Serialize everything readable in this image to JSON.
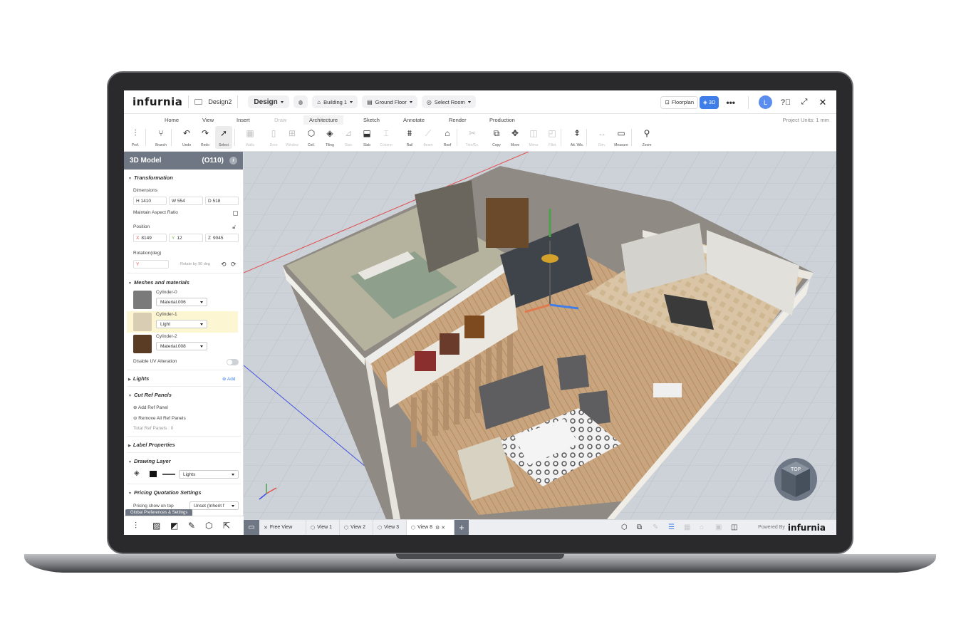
{
  "app": {
    "logo": "infurnia",
    "document_name": "Design2",
    "mode_label": "Design",
    "building": "Building 1",
    "floor": "Ground Floor",
    "room": "Select Room",
    "floorplan_label": "Floorplan",
    "view_3d_label": "3D",
    "more_label": "•••",
    "avatar_initial": "L",
    "help_icon": "question-circle-icon",
    "fullscreen_icon": "expand-icon",
    "close_icon": "close-icon"
  },
  "menu": {
    "tabs": [
      "Home",
      "View",
      "Insert",
      "Draw",
      "Architecture",
      "Sketch",
      "Annotate",
      "Render",
      "Production"
    ],
    "active": "Architecture",
    "project_units": "Project Units:  1 mm"
  },
  "toolbar": {
    "tools": [
      {
        "label": "Prof.",
        "glyph": "⫶"
      },
      {
        "label": "Branch",
        "glyph": "⑂"
      },
      {
        "label": "Undo",
        "glyph": "↶"
      },
      {
        "label": "Redo",
        "glyph": "↷"
      },
      {
        "label": "Select",
        "glyph": "➚"
      },
      {
        "label": "Walls",
        "glyph": "▦"
      },
      {
        "label": "Door",
        "glyph": "▯"
      },
      {
        "label": "Window",
        "glyph": "⊞"
      },
      {
        "label": "Ceil.",
        "glyph": "⬡"
      },
      {
        "label": "Tiling",
        "glyph": "◈"
      },
      {
        "label": "Stair",
        "glyph": "⊿"
      },
      {
        "label": "Slab",
        "glyph": "⬓"
      },
      {
        "label": "Column",
        "glyph": "⌶"
      },
      {
        "label": "Rail",
        "glyph": "⩩"
      },
      {
        "label": "Beam",
        "glyph": "⟋"
      },
      {
        "label": "Roof",
        "glyph": "⌂"
      },
      {
        "label": "Trim/Ex.",
        "glyph": "✂"
      },
      {
        "label": "Copy",
        "glyph": "⧉"
      },
      {
        "label": "Move",
        "glyph": "✥"
      },
      {
        "label": "Mirror",
        "glyph": "◫"
      },
      {
        "label": "Fillet",
        "glyph": "◰"
      },
      {
        "label": "Att. Wls.",
        "glyph": "⇞"
      },
      {
        "label": "Dim.",
        "glyph": "↔"
      },
      {
        "label": "Measure",
        "glyph": "▭"
      },
      {
        "label": "Zoom",
        "glyph": "⚲"
      }
    ]
  },
  "sidebar": {
    "title": "3D Model",
    "code": "(O110)",
    "info": "i",
    "transformation": {
      "header": "Transformation",
      "dimensions_label": "Dimensions",
      "h": "H 1410",
      "w": "W 554",
      "d": "D 518",
      "aspect_label": "Maintain Aspect Ratio",
      "position_label": "Position",
      "x_axis": "X",
      "x": "8149",
      "y_axis": "Y",
      "y": "12",
      "z_axis": "Z",
      "z": "9045",
      "rotation_label": "Rotation(deg)",
      "rotation_axis": "Y",
      "rotate_hint": "Rotate by 90 deg"
    },
    "meshes": {
      "header": "Meshes and materials",
      "items": [
        {
          "name": "Cylinder-0",
          "material": "Material.006",
          "color": "#7a7a7a"
        },
        {
          "name": "Cylinder-1",
          "material": "Light",
          "color": "#d9cdb4"
        },
        {
          "name": "Cylinder-2",
          "material": "Material.008",
          "color": "#5a3b24"
        }
      ],
      "disable_uv_label": "Disable UV Alteration"
    },
    "lights": {
      "header": "Lights",
      "add_label": "Add"
    },
    "cut_ref": {
      "header": "Cut Ref Panels",
      "add_label": "Add Ref Panel",
      "remove_label": "Remove All Ref Panels",
      "total_label": "Total Ref Panels : 0"
    },
    "label_properties": {
      "header": "Label Properties"
    },
    "drawing_layer": {
      "header": "Drawing Layer",
      "layer": "Lights"
    },
    "pricing": {
      "header": "Pricing Quotation Settings",
      "show_on_top_label": "Pricing show on top",
      "show_on_top_value": "Unset (Inherit f"
    },
    "global_pref_tab": "Global Preferences & Settings"
  },
  "viewtabs": {
    "tabs": [
      "Free View",
      "View 1",
      "View 2",
      "View 3",
      "View 8"
    ],
    "active": "View 8",
    "powered_by": "Powered By",
    "powered_logo": "infurnia"
  },
  "viewcube_label": "TOP"
}
